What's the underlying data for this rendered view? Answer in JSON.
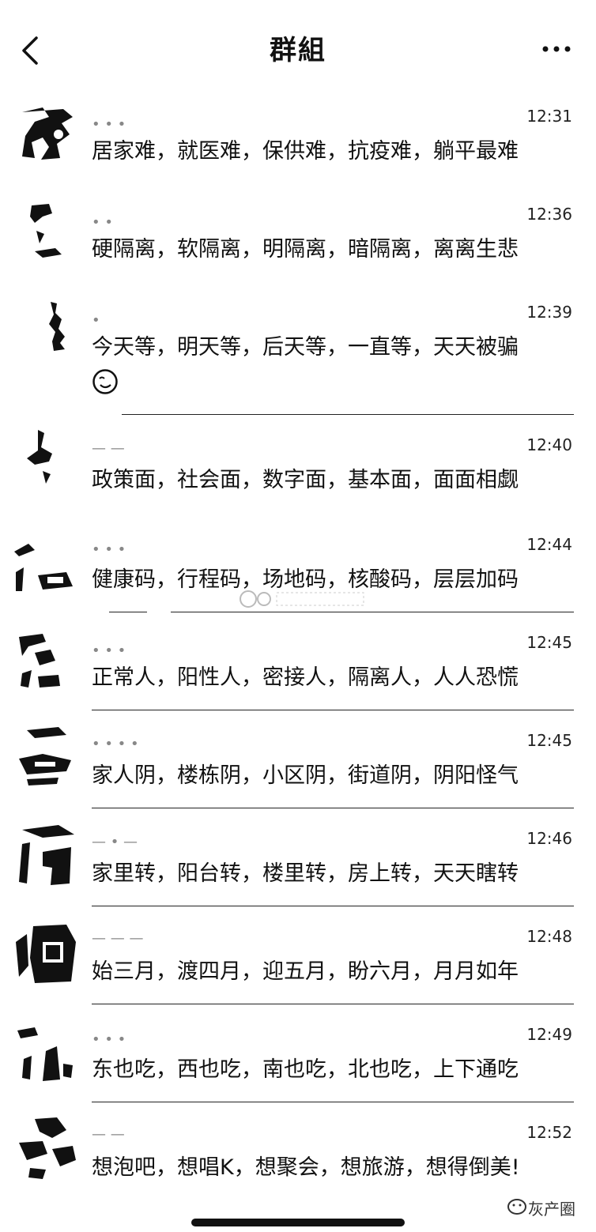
{
  "header": {
    "title": "群組"
  },
  "messages": [
    {
      "time": "12:31",
      "text": "居家难，就医难，保供难，抗疫难，躺平最难"
    },
    {
      "time": "12:36",
      "text": "硬隔离，软隔离，明隔离，暗隔离，离离生悲"
    },
    {
      "time": "12:39",
      "text": "今天等，明天等，后天等，一直等，天天被骗"
    },
    {
      "time": "12:40",
      "text": "政策面，社会面，数字面，基本面，面面相觑"
    },
    {
      "time": "12:44",
      "text": "健康码，行程码，场地码，核酸码，层层加码"
    },
    {
      "time": "12:45",
      "text": "正常人，阳性人，密接人，隔离人，人人恐慌"
    },
    {
      "time": "12:45",
      "text": "家人阴，楼栋阴，小区阴，街道阴，阴阳怪气"
    },
    {
      "time": "12:46",
      "text": "家里转，阳台转，楼里转，房上转，天天瞎转"
    },
    {
      "time": "12:48",
      "text": "始三月，渡四月，迎五月，盼六月，月月如年"
    },
    {
      "time": "12:49",
      "text": "东也吃，西也吃，南也吃，北也吃，上下通吃"
    },
    {
      "time": "12:52",
      "text": "想泡吧，想唱K，想聚会，想旅游，想得倒美!"
    }
  ],
  "watermark": {
    "brand": "灰产圈"
  },
  "icons": {
    "back": "chevron-left-icon",
    "more": "more-dots-icon",
    "emoji": "face-emoji-icon"
  }
}
